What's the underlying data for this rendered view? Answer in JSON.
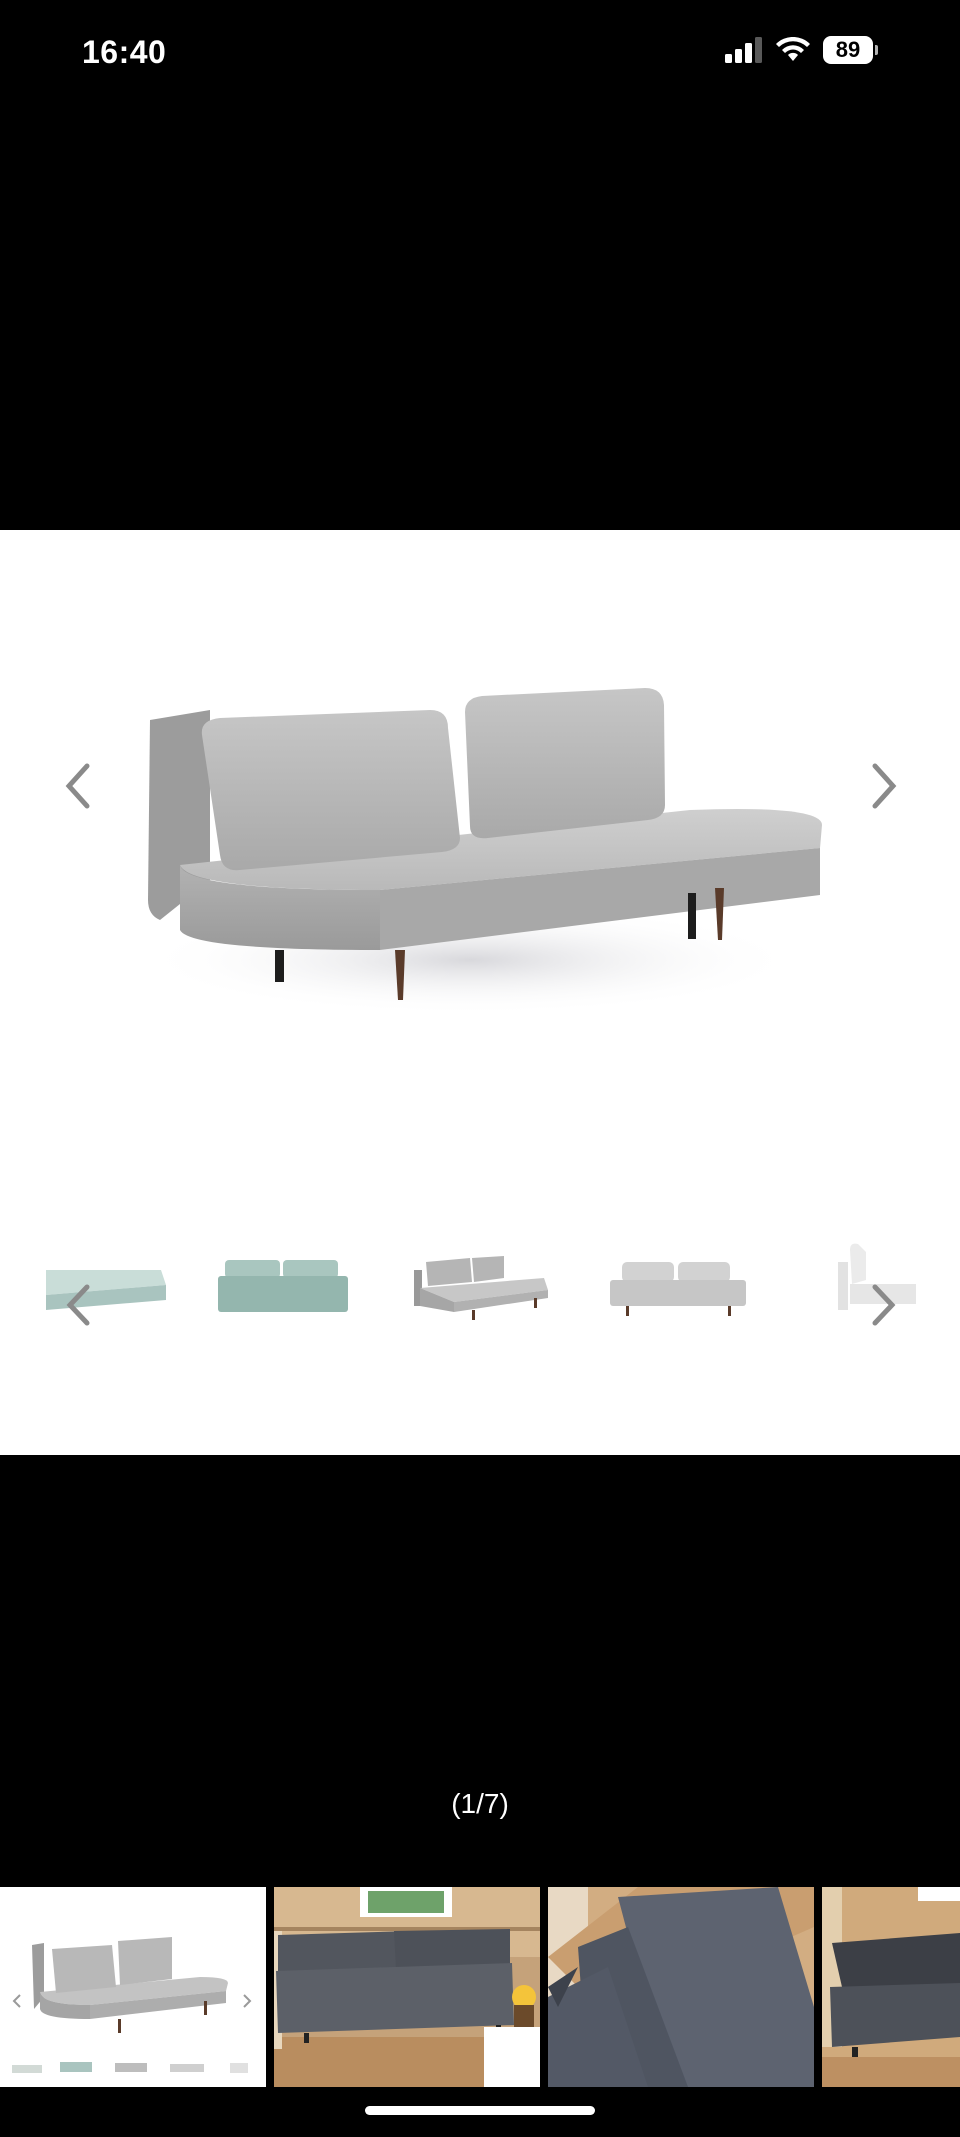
{
  "status_bar": {
    "time": "16:40",
    "battery_level": "89",
    "icons": [
      "cellular-signal-icon",
      "wifi-icon",
      "battery-icon"
    ]
  },
  "viewer": {
    "main_image": "sofa-bed-grey-product-photo",
    "prev_icon": "chevron-left-icon",
    "next_icon": "chevron-right-icon",
    "thumbnails": [
      "sofa-bed-mint-open-thumbnail",
      "sofa-mint-front-thumbnail",
      "sofa-grey-angle-thumbnail",
      "sofa-light-grey-front-thumbnail",
      "sofa-white-side-thumbnail"
    ]
  },
  "counter": {
    "text": "(1/7)",
    "current": 1,
    "total": 7
  },
  "gallery": {
    "items": [
      "product-photo-thumbnail",
      "living-room-sofa-photo",
      "sofa-closeup-photo",
      "sofa-room-photo"
    ],
    "selected_index": 0
  },
  "colors": {
    "background": "#000000",
    "viewer_bg": "#ffffff",
    "arrow": "#8a8a8a"
  }
}
